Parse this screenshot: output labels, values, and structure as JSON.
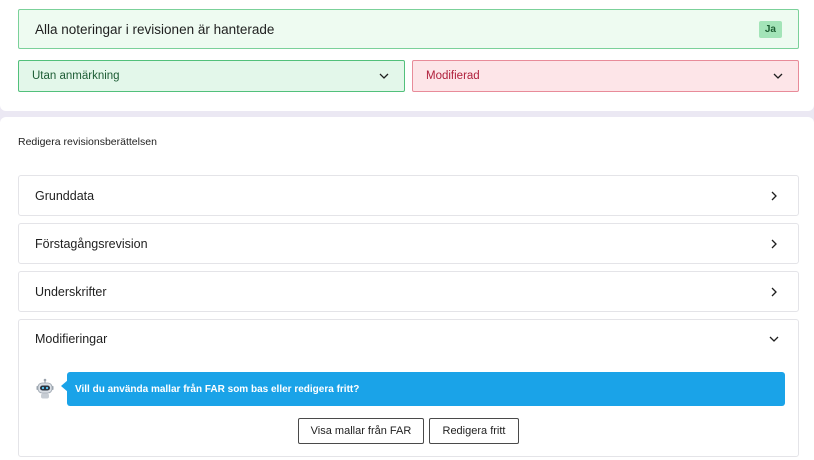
{
  "review": {
    "status_text": "Alla noteringar i revisionen är hanterade",
    "status_badge": "Ja",
    "select_left": "Utan anmärkning",
    "select_right": "Modifierad"
  },
  "editor": {
    "heading": "Redigera revisionsberättelsen",
    "sections": [
      {
        "label": "Grunddata"
      },
      {
        "label": "Förstagångsrevision"
      },
      {
        "label": "Underskrifter"
      },
      {
        "label": "Modifieringar"
      }
    ],
    "assistant_message": "Vill du använda mallar från FAR som bas eller redigera fritt?",
    "btn_templates": "Visa mallar från FAR",
    "btn_free": "Redigera fritt"
  },
  "icons": {
    "select_caret": "chevron-down-icon",
    "section_closed": "chevron-right-icon",
    "section_open": "chevron-down-icon",
    "assistant": "robot-icon"
  },
  "colors": {
    "success_bg": "#eefbf1",
    "success_border": "#7bd19a",
    "danger_bg": "#fde5e8",
    "danger_text": "#b0203c",
    "assistant_blue": "#1aa3e8"
  }
}
